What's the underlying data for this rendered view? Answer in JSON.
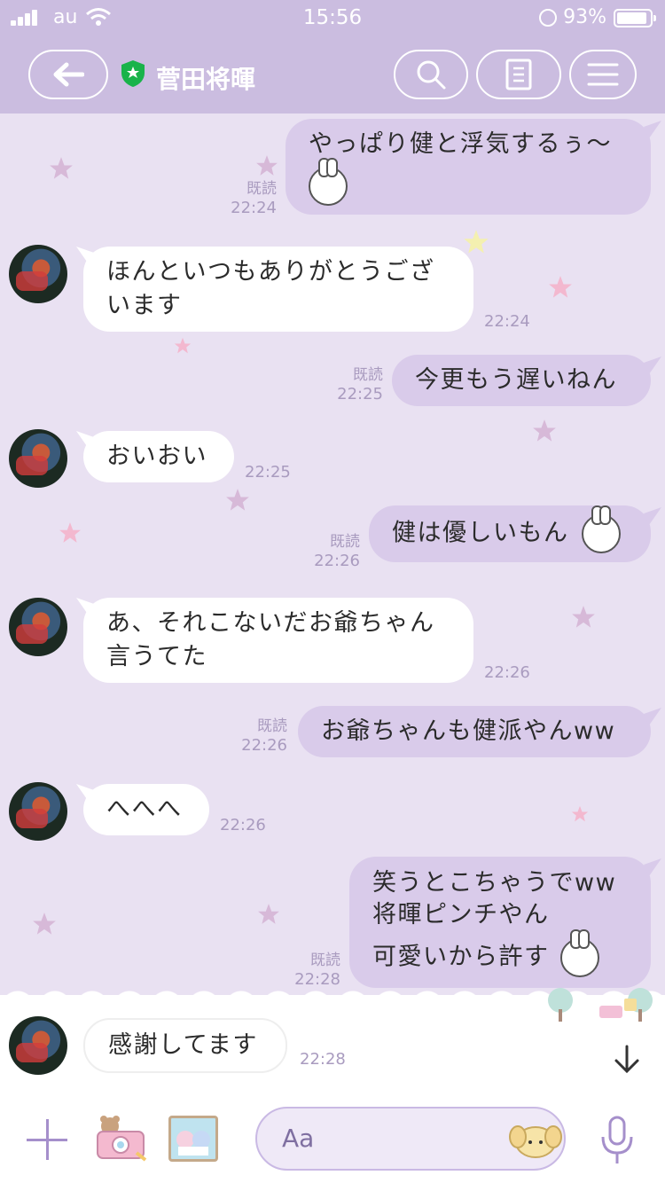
{
  "status": {
    "carrier": "au",
    "time": "15:56",
    "battery_pct": "93%",
    "battery_level": 0.93
  },
  "nav": {
    "contact_name": "菅田将暉"
  },
  "messages": [
    {
      "dir": "out",
      "text": "やっぱり健と浮気するぅ〜",
      "emoji": "crying-bunny-emoji",
      "read": "既読",
      "time": "22:24"
    },
    {
      "dir": "in",
      "lines": [
        "ほんといつもありがとうござ",
        "います"
      ],
      "time": "22:24"
    },
    {
      "dir": "out",
      "text": "今更もう遅いねん",
      "read": "既読",
      "time": "22:25"
    },
    {
      "dir": "in",
      "lines": [
        "おいおい"
      ],
      "time": "22:25"
    },
    {
      "dir": "out",
      "text": "健は優しいもん",
      "emoji": "smiling-bunny-emoji",
      "read": "既読",
      "time": "22:26"
    },
    {
      "dir": "in",
      "lines": [
        "あ、それこないだお爺ちゃん",
        "言うてた"
      ],
      "time": "22:26"
    },
    {
      "dir": "out",
      "text": "お爺ちゃんも健派やんww",
      "read": "既読",
      "time": "22:26"
    },
    {
      "dir": "in",
      "lines": [
        "へへへ"
      ],
      "time": "22:26"
    },
    {
      "dir": "out",
      "lines": [
        "笑うとこちゃうでww",
        "将暉ピンチやん",
        "可愛いから許す"
      ],
      "emoji": "heart-eyes-bunny-emoji",
      "read": "既読",
      "time": "22:28"
    },
    {
      "dir": "in",
      "lines": [
        "感謝してます"
      ],
      "time": "22:28"
    }
  ],
  "input": {
    "placeholder": "Aa"
  },
  "colors": {
    "header": "#cbbde0",
    "background": "#e9e1f2",
    "bubble_out": "#d9cbea",
    "bubble_in": "#ffffff",
    "accent": "#a58fcb"
  }
}
